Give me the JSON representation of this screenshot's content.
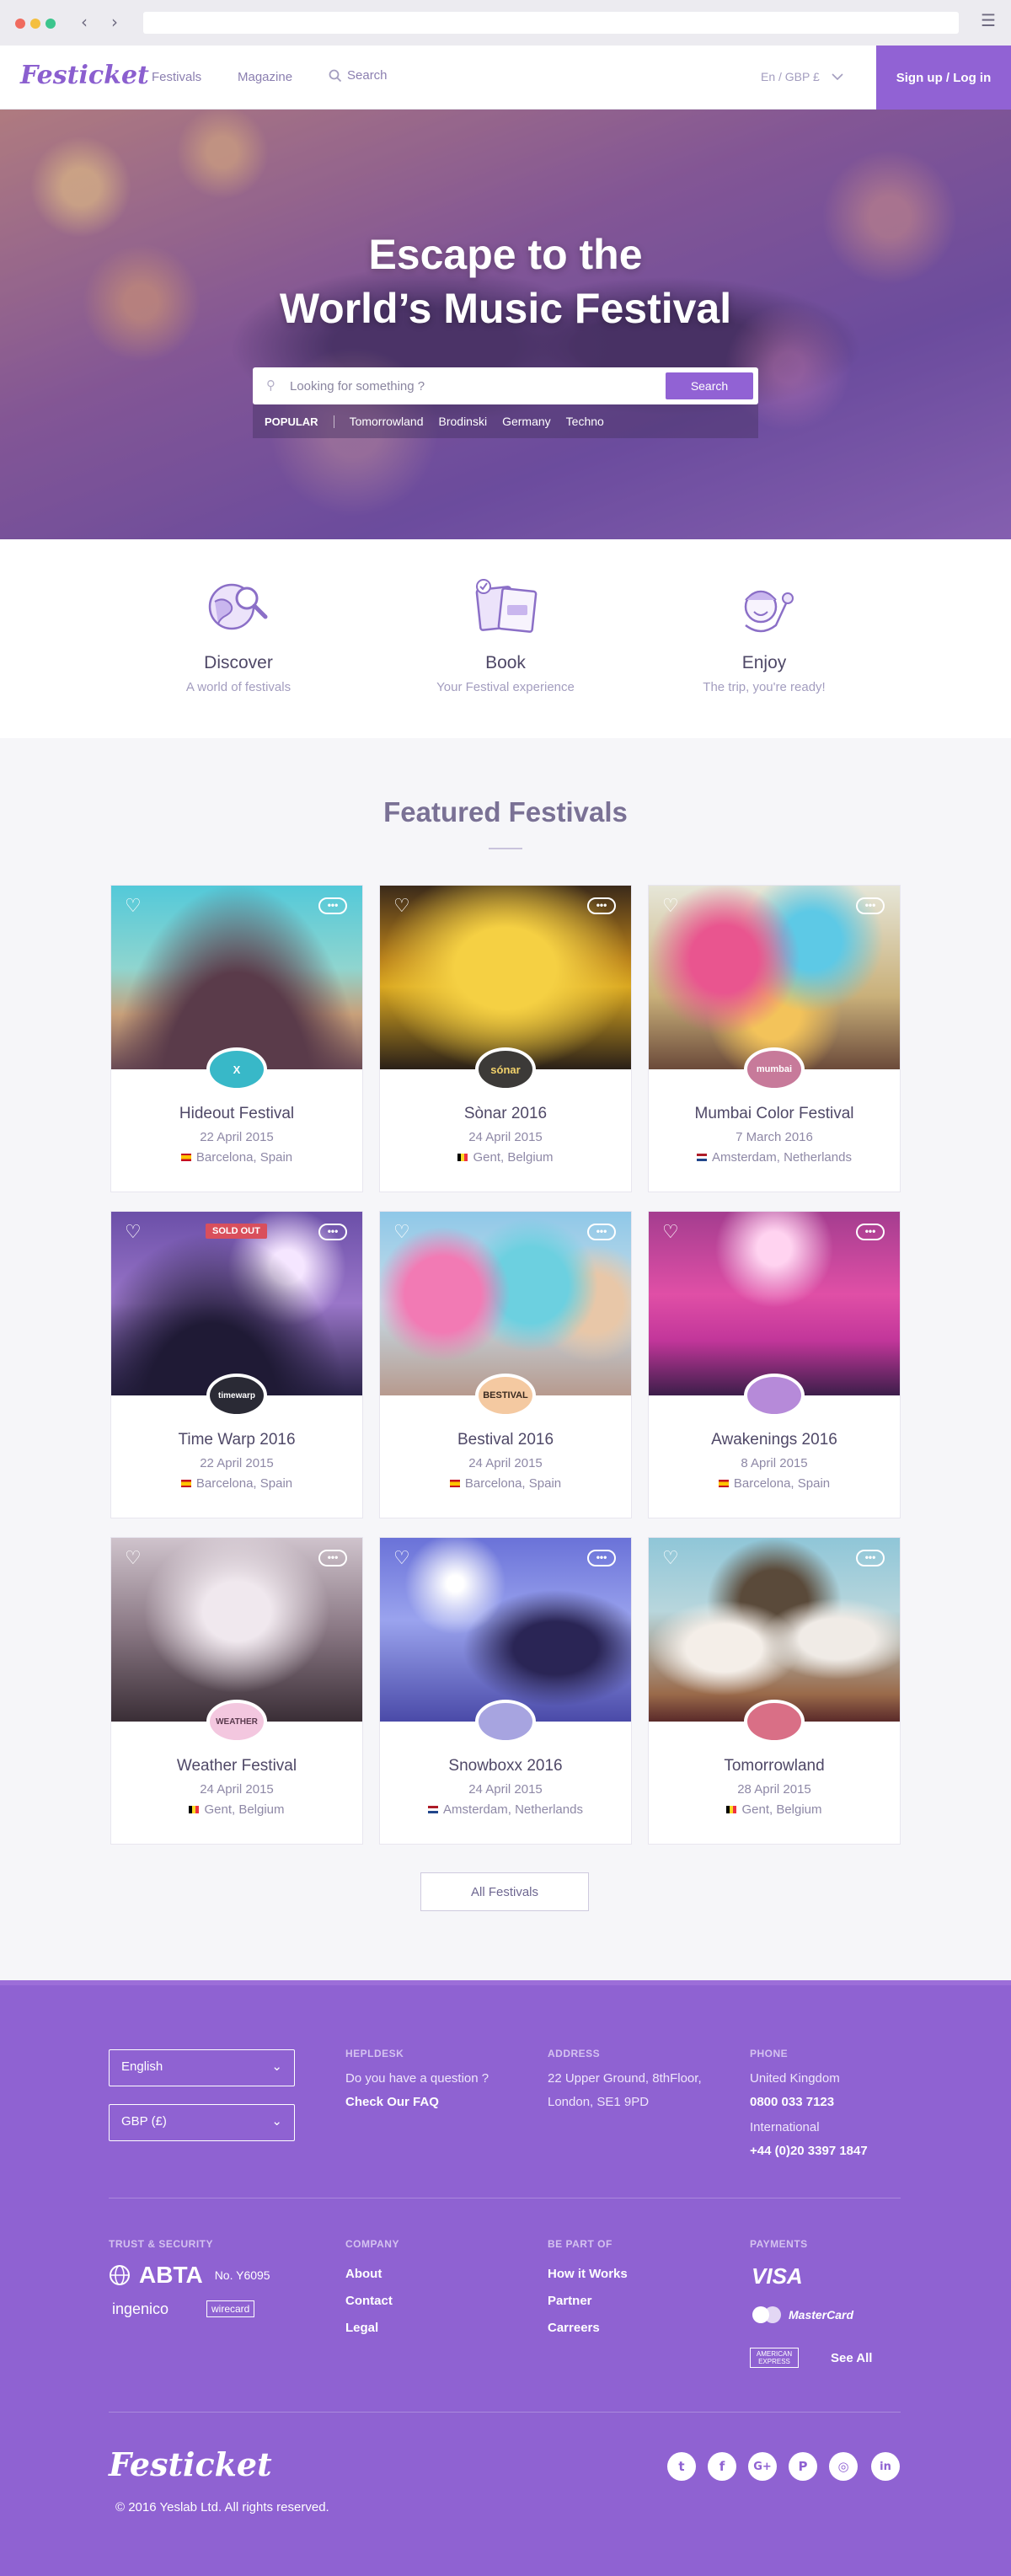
{
  "header": {
    "logo": "Festicket",
    "nav": [
      "Festivals",
      "Magazine"
    ],
    "search_label": "Search",
    "lang": "En / GBP £",
    "signup": "Sign up / Log in"
  },
  "hero": {
    "title_line1": "Escape to the",
    "title_line2": "World’s Music Festival",
    "search_placeholder": "Looking for something ?",
    "search_button": "Search",
    "popular_label": "POPULAR",
    "popular_tags": [
      "Tomorrowland",
      "Brodinski",
      "Germany",
      "Techno"
    ]
  },
  "features": [
    {
      "title": "Discover",
      "subtitle": "A world of festivals",
      "icon": "globe-magnifier-icon"
    },
    {
      "title": "Book",
      "subtitle": "Your Festival experience",
      "icon": "tickets-icon"
    },
    {
      "title": "Enjoy",
      "subtitle": "The trip, you're ready!",
      "icon": "happy-person-icon"
    }
  ],
  "featured": {
    "title": "Featured Festivals",
    "sold_out_label": "SOLD OUT",
    "festivals": [
      {
        "name": "Hideout Festival",
        "date": "22 April 2015",
        "location": "Barcelona, Spain",
        "flag": "spain"
      },
      {
        "name": "Sònar 2016",
        "date": "24 April 2015",
        "location": "Gent, Belgium",
        "flag": "belgium"
      },
      {
        "name": "Mumbai Color Festival",
        "date": "7 March 2016",
        "location": "Amsterdam, Netherlands",
        "flag": "netherlands"
      },
      {
        "name": "Time Warp 2016",
        "date": "22 April 2015",
        "location": "Barcelona, Spain",
        "flag": "spain"
      },
      {
        "name": "Bestival 2016",
        "date": "24 April 2015",
        "location": "Barcelona, Spain",
        "flag": "spain"
      },
      {
        "name": "Awakenings 2016",
        "date": "8 April 2015",
        "location": "Barcelona, Spain",
        "flag": "spain"
      },
      {
        "name": "Weather Festival",
        "date": "24 April 2015",
        "location": "Gent, Belgium",
        "flag": "belgium"
      },
      {
        "name": "Snowboxx 2016",
        "date": "24 April 2015",
        "location": "Amsterdam, Netherlands",
        "flag": "netherlands"
      },
      {
        "name": "Tomorrowland",
        "date": "28 April 2015",
        "location": "Gent, Belgium",
        "flag": "belgium"
      }
    ],
    "badges": [
      "X",
      "sónar",
      "mumbai",
      "timewarp",
      "BESTIVAL",
      "",
      "WEATHER",
      "",
      ""
    ],
    "all_button": "All Festivals"
  },
  "footer": {
    "language": "English",
    "currency": "GBP (£)",
    "help_heading": "HEPLDESK",
    "help_question": "Do you have a question ?",
    "help_link": "Check Our FAQ",
    "address_heading": "ADDRESS",
    "address_line1": "22 Upper Ground, 8thFloor,",
    "address_line2": "London, SE1 9PD",
    "phone_heading": "PHONE",
    "phone_uk_label": "United Kingdom",
    "phone_uk": "0800 033 7123",
    "phone_int_label": "International",
    "phone_int": "+44 (0)20 3397 1847",
    "trust_heading": "TRUST & SECURITY",
    "abta": "ABTA",
    "abta_no": "No. Y6095",
    "ingenico": "ingenico",
    "wirecard": "wirecard",
    "company_heading": "COMPANY",
    "company_links": [
      "About",
      "Contact",
      "Legal"
    ],
    "bepart_heading": "BE PART OF",
    "bepart_links": [
      "How it Works",
      "Partner",
      "Carreers"
    ],
    "payments_heading": "PAYMENTS",
    "visa": "VISA",
    "mastercard": "MasterCard",
    "amex": "AMERICAN EXPRESS",
    "see_all": "See All",
    "logo": "Festicket",
    "copyright": "© 2016 Yeslab Ltd. All rights reserved.",
    "social": [
      "twitter-icon",
      "facebook-icon",
      "google-plus-icon",
      "pinterest-icon",
      "instagram-icon",
      "linkedin-icon"
    ],
    "social_glyphs": [
      "t",
      "f",
      "G+",
      "P",
      "◎",
      "in"
    ]
  }
}
